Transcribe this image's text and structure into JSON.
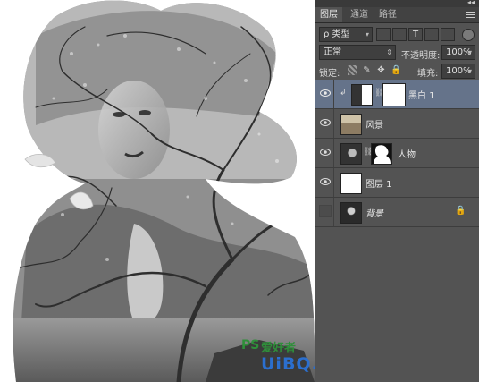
{
  "panel": {
    "tabs": [
      {
        "label": "图层",
        "active": true
      },
      {
        "label": "通道",
        "active": false
      },
      {
        "label": "路径",
        "active": false
      }
    ],
    "filter": {
      "label": "ρ 类型"
    },
    "blend_mode": "正常",
    "opacity": {
      "label": "不透明度:",
      "value": "100%"
    },
    "lock": {
      "label": "锁定:"
    },
    "fill": {
      "label": "填充:",
      "value": "100%"
    },
    "layers": [
      {
        "name": "黑白 1",
        "type": "adjustment",
        "visible": true,
        "selected": true,
        "mask": true
      },
      {
        "name": "风景",
        "type": "image",
        "visible": true,
        "selected": false,
        "mask": false
      },
      {
        "name": "人物",
        "type": "image",
        "visible": true,
        "selected": false,
        "mask": true
      },
      {
        "name": "图层 1",
        "type": "fill",
        "visible": true,
        "selected": false,
        "mask": false
      },
      {
        "name": "背景",
        "type": "background",
        "visible": false,
        "selected": false,
        "locked": true
      }
    ]
  },
  "watermark": {
    "brand_small": "PS",
    "site_cn": "爱好者",
    "url": "UiBQ.CoM"
  },
  "colors": {
    "panel_bg": "#535353",
    "selected_layer": "#65738a",
    "watermark_blue": "#2b6fcf",
    "watermark_green": "#2f8f3a"
  }
}
